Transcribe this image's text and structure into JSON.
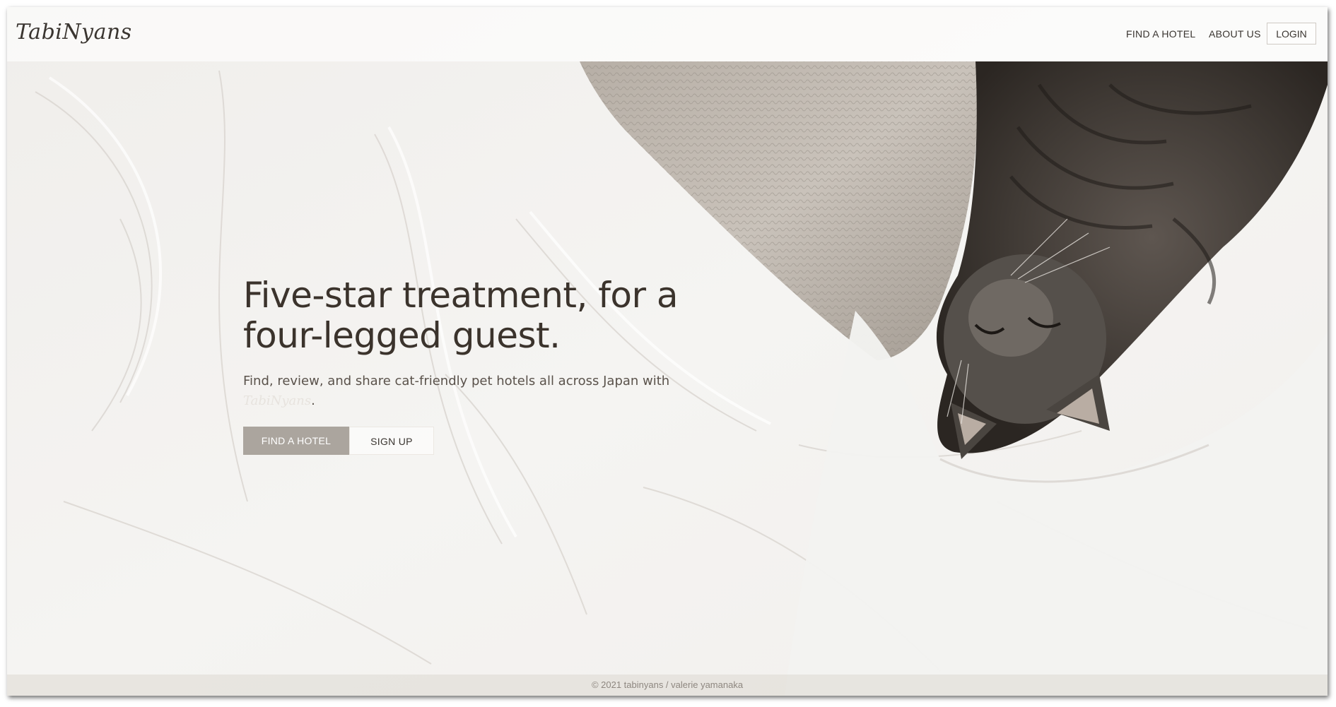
{
  "navbar": {
    "brand": "TabiNyans",
    "links": [
      "FIND A HOTEL",
      "ABOUT US"
    ],
    "login_label": "LOGIN"
  },
  "hero": {
    "headline_line1": "Five-star treatment, for a",
    "headline_line2": "four-legged guest.",
    "subtext": "Find, review, and share cat-friendly pet hotels all across Japan with",
    "subtext_brand": "TabiNyans",
    "subtext_end": ".",
    "primary_button": "FIND A HOTEL",
    "secondary_button": "SIGN UP",
    "image": "sleeping-tabby-cat-in-white-sheets"
  },
  "footer": {
    "text": "© 2021 tabinyans / valerie yamanaka"
  },
  "colors": {
    "text_dark": "#3b332c",
    "button_primary": "#aba59e",
    "background": "#f1efec"
  }
}
